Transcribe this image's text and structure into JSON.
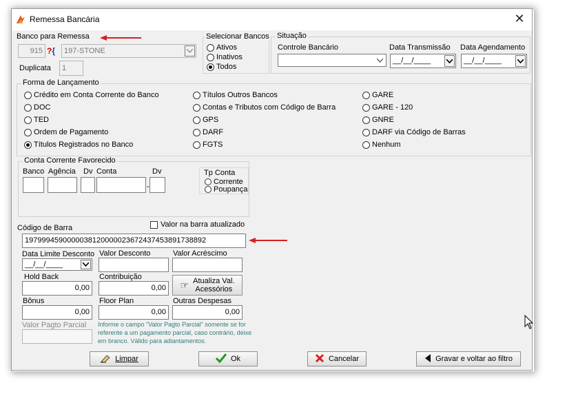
{
  "window": {
    "title": "Remessa Bancária"
  },
  "banco": {
    "label": "Banco para Remessa",
    "code": "915",
    "lookup_icon": "search-question-icon",
    "name": "197-STONE",
    "duplicata_label": "Duplicata",
    "duplicata_value": "1"
  },
  "selecionar_bancos": {
    "title": "Selecionar Bancos",
    "options": [
      "Ativos",
      "Inativos",
      "Todos"
    ],
    "selected": "Todos"
  },
  "situacao": {
    "title": "Situação",
    "controle_label": "Controle Bancário",
    "controle_value": "",
    "transmissao_label": "Data Transmissão",
    "transmissao_value": "__/__/____",
    "agendamento_label": "Data Agendamento",
    "agendamento_value": "__/__/____"
  },
  "forma": {
    "title": "Forma de Lançamento",
    "col1": [
      "Crédito em Conta Corrente do Banco",
      "DOC",
      "TED",
      "Ordem de Pagamento",
      "Títulos Registrados no Banco"
    ],
    "col2": [
      "Títulos Outros Bancos",
      "Contas e Tributos com Código de Barra",
      "GPS",
      "DARF",
      "FGTS"
    ],
    "col3": [
      "GARE",
      "GARE - 120",
      "GNRE",
      "DARF via Código de Barras",
      "Nenhum"
    ],
    "selected": "Títulos Registrados no Banco"
  },
  "conta": {
    "title": "Conta Corrente Favorecido",
    "banco_label": "Banco",
    "agencia_label": "Agência",
    "dv_label": "Dv",
    "conta_label": "Conta",
    "dv2_label": "Dv",
    "dash": "-",
    "tp_title": "Tp Conta",
    "tp_options": [
      "Corrente",
      "Poupança"
    ]
  },
  "codigo": {
    "label": "Código de Barra",
    "value": "19799945900000381200000236724374538917388​92",
    "valor_atualizado_label": "Valor na barra atualizado"
  },
  "campos": {
    "data_limite_label": "Data Limite Desconto",
    "data_limite_value": "__/__/____",
    "valor_desconto_label": "Valor Desconto",
    "valor_desconto_value": "",
    "valor_acrescimo_label": "Valor Acréscimo",
    "valor_acrescimo_value": "",
    "hold_back_label": "Hold Back",
    "hold_back_value": "0,00",
    "contribuicao_label": "Contribuição",
    "contribuicao_value": "0,00",
    "atualiza_label_1": "Atualiza Val.",
    "atualiza_label_2": "Acessórios",
    "bonus_label": "Bônus",
    "bonus_value": "0,00",
    "floor_plan_label": "Floor Plan",
    "floor_plan_value": "0,00",
    "outras_label": "Outras Despesas",
    "outras_value": "0,00",
    "parcial_label": "Valor Pagto Parcial",
    "parcial_value": "",
    "note": "Informe o campo \"Valor Pagto Parcial\" somente se for referente a um pagamento parcial, caso contrário, deixe em branco. Válido para adiantamentos."
  },
  "buttons": {
    "limpar": "Limpar",
    "ok": "Ok",
    "cancelar": "Cancelar",
    "gravar": "Gravar e voltar ao filtro"
  },
  "colors": {
    "accent_red": "#d62020",
    "note_teal": "#2f7d7d",
    "ok_green": "#1e9a1e"
  }
}
